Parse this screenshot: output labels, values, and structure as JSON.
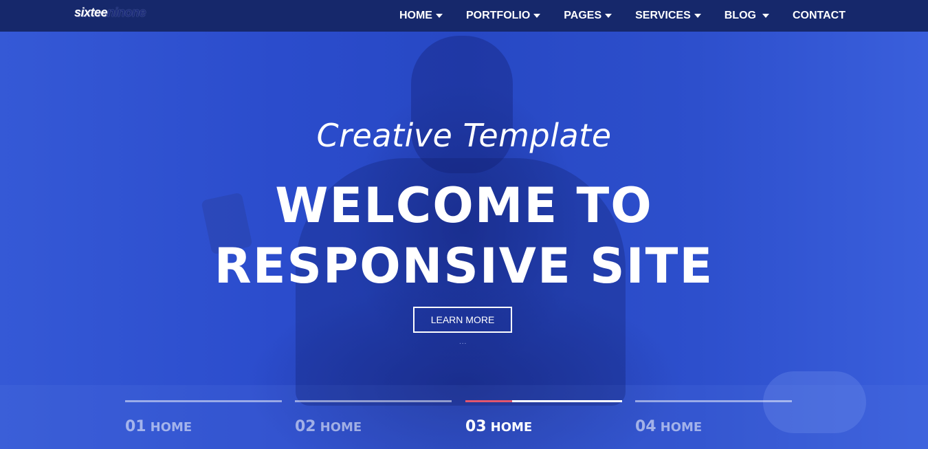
{
  "logo": {
    "part1": "sixtee",
    "part2": "ninone"
  },
  "nav": [
    {
      "label": "HOME",
      "dropdown": true
    },
    {
      "label": "PORTFOLIO",
      "dropdown": true
    },
    {
      "label": "PAGES",
      "dropdown": true
    },
    {
      "label": "SERVICES",
      "dropdown": true
    },
    {
      "label": "BLOG",
      "dropdown": true
    },
    {
      "label": "CONTACT",
      "dropdown": false
    }
  ],
  "hero": {
    "subtitle": "Creative Template",
    "headline_line1": "WELCOME TO",
    "headline_line2": "RESPONSIVE SITE",
    "button_label": "LEARN MORE",
    "loader_dots": "..."
  },
  "slider_tabs": [
    {
      "number": "01",
      "label": "HOME",
      "active": false
    },
    {
      "number": "02",
      "label": "HOME",
      "active": false
    },
    {
      "number": "03",
      "label": "HOME",
      "active": true,
      "progress": 0.3
    },
    {
      "number": "04",
      "label": "HOME",
      "active": false
    }
  ],
  "colors": {
    "navbar": "#16286b",
    "hero_overlay": "#2a4fc7",
    "progress_accent": "#e2566e"
  }
}
